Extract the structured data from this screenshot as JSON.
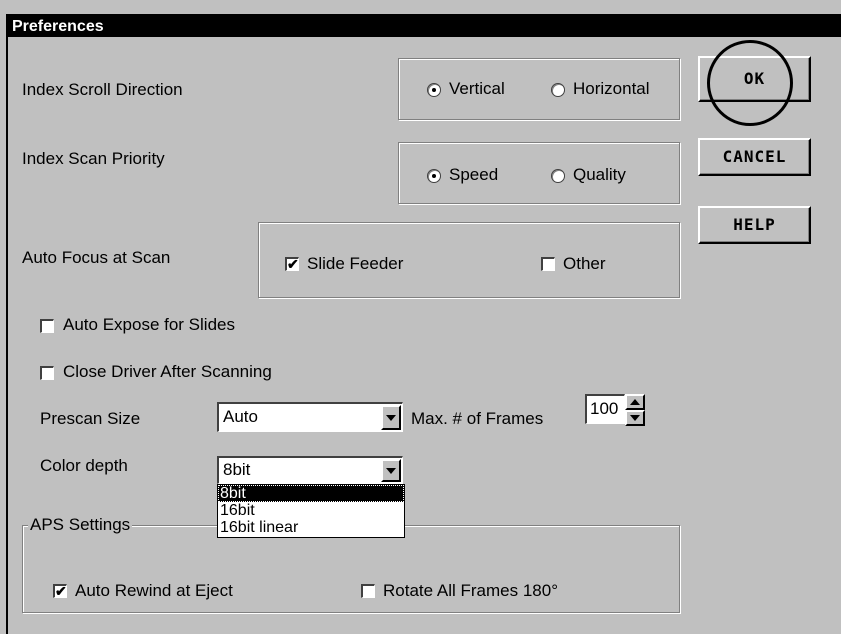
{
  "window": {
    "title": "Preferences"
  },
  "scroll_direction": {
    "label": "Index Scroll Direction",
    "options": [
      {
        "label": "Vertical",
        "selected": true
      },
      {
        "label": "Horizontal",
        "selected": false
      }
    ]
  },
  "scan_priority": {
    "label": "Index Scan Priority",
    "options": [
      {
        "label": "Speed",
        "selected": true
      },
      {
        "label": "Quality",
        "selected": false
      }
    ]
  },
  "auto_focus": {
    "label": "Auto Focus at Scan",
    "options": [
      {
        "label": "Slide Feeder",
        "checked": true
      },
      {
        "label": "Other",
        "checked": false
      }
    ]
  },
  "auto_expose": {
    "label": "Auto Expose for Slides",
    "checked": false
  },
  "close_driver": {
    "label": "Close Driver After Scanning",
    "checked": false
  },
  "prescan": {
    "label": "Prescan Size",
    "value": "Auto"
  },
  "max_frames": {
    "label": "Max. # of Frames",
    "value": "100"
  },
  "color_depth": {
    "label": "Color depth",
    "value": "8bit",
    "options": [
      "8bit",
      "16bit",
      "16bit linear"
    ],
    "highlighted": "8bit"
  },
  "aps": {
    "label": "APS Settings",
    "auto_rewind": {
      "label": "Auto Rewind at Eject",
      "checked": true
    },
    "rotate": {
      "label": "Rotate All Frames 180°",
      "checked": false
    }
  },
  "buttons": {
    "ok": "OK",
    "cancel": "CANCEL",
    "help": "HELP"
  },
  "check_mark": "✔"
}
